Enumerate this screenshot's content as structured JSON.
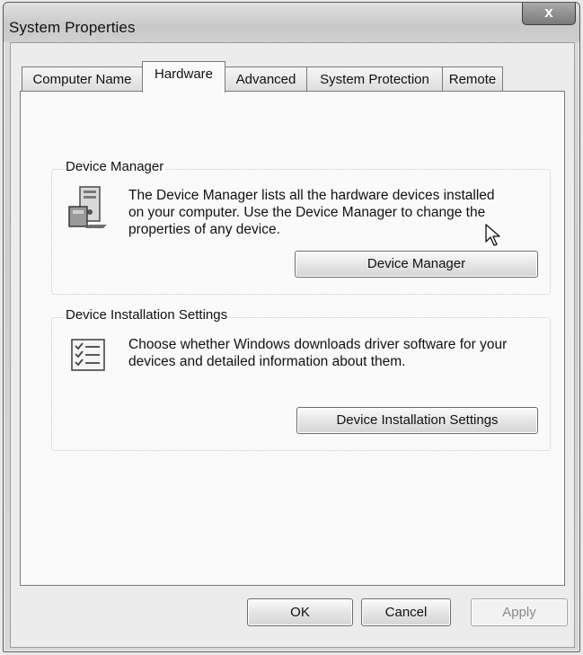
{
  "window": {
    "title": "System Properties",
    "close_label": "x"
  },
  "tabs": [
    {
      "label": "Computer Name",
      "active": false
    },
    {
      "label": "Hardware",
      "active": true
    },
    {
      "label": "Advanced",
      "active": false
    },
    {
      "label": "System Protection",
      "active": false
    },
    {
      "label": "Remote",
      "active": false
    }
  ],
  "device_manager": {
    "heading": "Device Manager",
    "description": [
      "The Device Manager lists all the hardware devices installed",
      "on your computer. Use the Device Manager to change the",
      "properties of any device."
    ],
    "button_label": "Device Manager",
    "icon": "device-manager-icon"
  },
  "device_installation": {
    "heading": "Device Installation Settings",
    "description": [
      "Choose whether Windows downloads driver software for your",
      "devices and detailed information about them."
    ],
    "button_label": "Device Installation Settings",
    "icon": "checklist-icon"
  },
  "footer": {
    "ok_label": "OK",
    "cancel_label": "Cancel",
    "apply_label": "Apply"
  }
}
